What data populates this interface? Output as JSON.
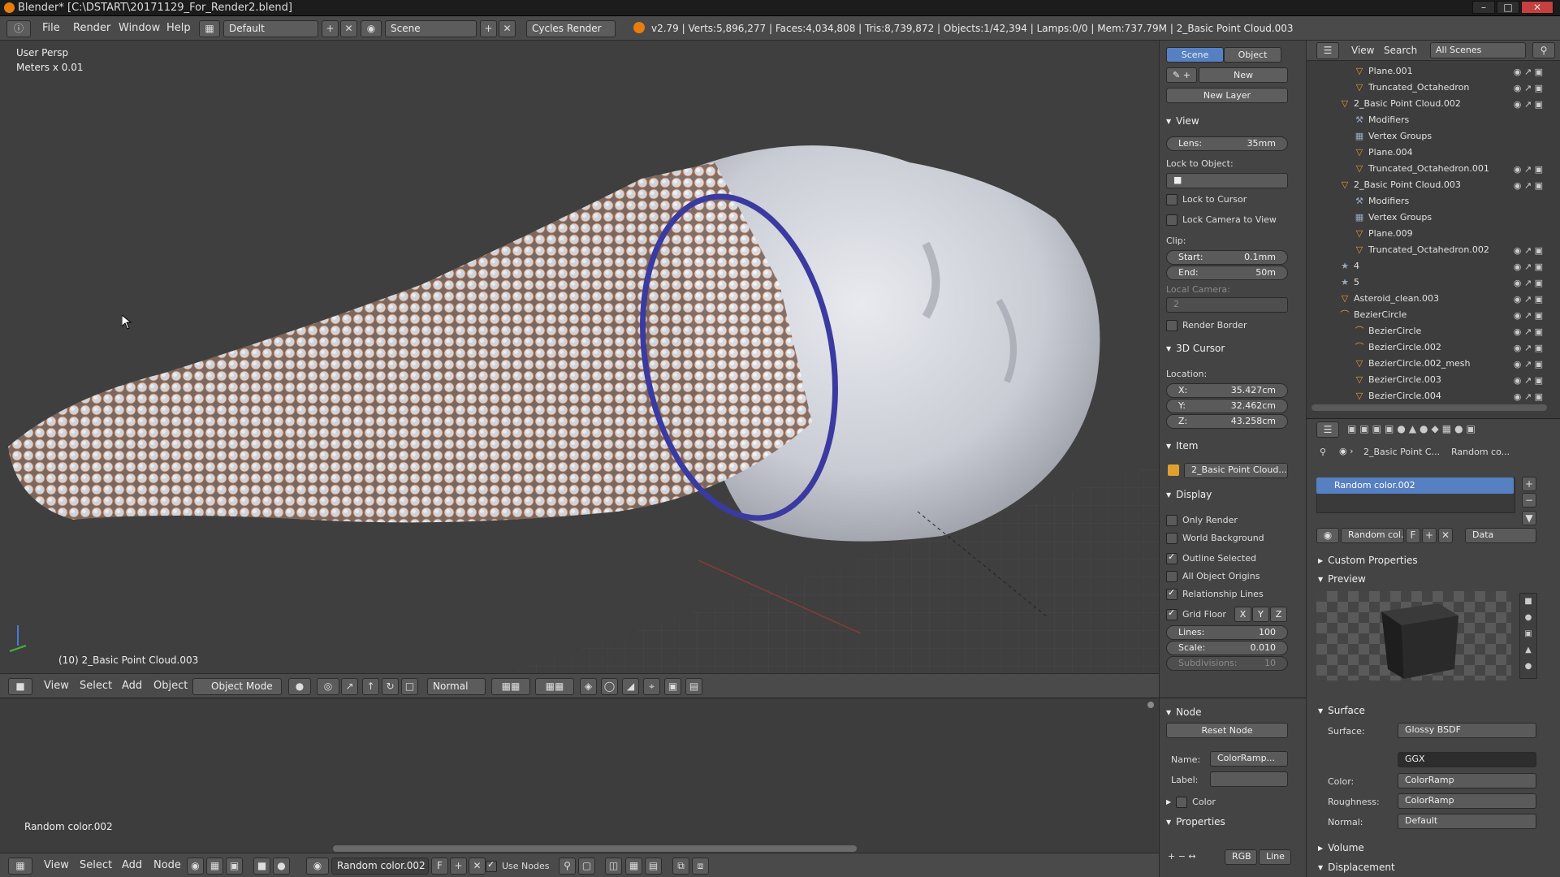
{
  "window": {
    "title": "Blender* [C:\\DSTART\\20171129_For_Render2.blend]",
    "minimize": "–",
    "maximize": "□",
    "close": "✕"
  },
  "info_header": {
    "menus": [
      "File",
      "Render",
      "Window",
      "Help"
    ],
    "screen_layout": "Default",
    "scene": "Scene",
    "render_engine": "Cycles Render",
    "stats": "v2.79 | Verts:5,896,277 | Faces:4,034,808 | Tris:8,739,872 | Objects:1/42,394 | Lamps:0/0 | Mem:737.79M | 2_Basic Point Cloud.003"
  },
  "viewport": {
    "view_name": "User Persp",
    "units": "Meters x 0.01",
    "active_object": "(10) 2_Basic Point Cloud.003"
  },
  "viewport_header": {
    "menus": [
      "View",
      "Select",
      "Add",
      "Object"
    ],
    "mode": "Object Mode",
    "orientation": "Normal"
  },
  "n_panel": {
    "tabs": [
      "Scene",
      "Object"
    ],
    "new_button": "New",
    "new_layer_button": "New Layer",
    "view": {
      "title": "View",
      "lens_label": "Lens:",
      "lens_value": "35mm",
      "lock_to_object": "Lock to Object:",
      "lock_to_cursor": "Lock to Cursor",
      "lock_camera_to_view": "Lock Camera to View",
      "clip": "Clip:",
      "clip_start_label": "Start:",
      "clip_start_value": "0.1mm",
      "clip_end_label": "End:",
      "clip_end_value": "50m",
      "local_camera": "Local Camera:",
      "local_camera_value": "2",
      "render_border": "Render Border"
    },
    "cursor_3d": {
      "title": "3D Cursor",
      "location": "Location:",
      "x_label": "X:",
      "x_value": "35.427cm",
      "y_label": "Y:",
      "y_value": "32.462cm",
      "z_label": "Z:",
      "z_value": "43.258cm"
    },
    "item": {
      "title": "Item",
      "name": "2_Basic Point Cloud..."
    },
    "display": {
      "title": "Display",
      "only_render": "Only Render",
      "world_background": "World Background",
      "outline_selected": "Outline Selected",
      "all_object_origins": "All Object Origins",
      "relationship_lines": "Relationship Lines",
      "grid_floor": "Grid Floor",
      "axis_x": "X",
      "axis_y": "Y",
      "axis_z": "Z",
      "lines_label": "Lines:",
      "lines_value": "100",
      "scale_label": "Scale:",
      "scale_value": "0.010",
      "subdivisions_label": "Subdivisions:",
      "subdivisions_value": "10"
    }
  },
  "node_panel": {
    "title": "Node",
    "reset_node": "Reset Node",
    "name_label": "Name:",
    "name_value": "ColorRamp...",
    "label_label": "Label:",
    "color_section": "Color",
    "properties_section": "Properties",
    "color_mode": "RGB",
    "interp": "Line"
  },
  "node_editor": {
    "material_label": "Random color.002",
    "menus": [
      "View",
      "Select",
      "Add",
      "Node"
    ],
    "material": "Random color.002",
    "fake_user": "F",
    "use_nodes": "Use Nodes"
  },
  "outliner": {
    "view_menu": "View",
    "search_menu": "Search",
    "scope": "All Scenes",
    "rows": [
      {
        "name": "Plane.001",
        "icon": "mesh-icon"
      },
      {
        "name": "Truncated_Octahedron",
        "icon": "mesh-icon"
      },
      {
        "name": "2_Basic Point Cloud.002",
        "icon": "mesh-icon"
      },
      {
        "name": "Modifiers",
        "icon": "wrench-icon"
      },
      {
        "name": "Vertex Groups",
        "icon": "vertex-groups-icon"
      },
      {
        "name": "Plane.004",
        "icon": "mesh-icon"
      },
      {
        "name": "Truncated_Octahedron.001",
        "icon": "mesh-icon"
      },
      {
        "name": "2_Basic Point Cloud.003",
        "icon": "mesh-icon"
      },
      {
        "name": "Modifiers",
        "icon": "wrench-icon"
      },
      {
        "name": "Vertex Groups",
        "icon": "vertex-groups-icon"
      },
      {
        "name": "Plane.009",
        "icon": "mesh-icon"
      },
      {
        "name": "Truncated_Octahedron.002",
        "icon": "mesh-icon"
      },
      {
        "name": "4",
        "icon": "group-icon"
      },
      {
        "name": "5",
        "icon": "group-icon"
      },
      {
        "name": "Asteroid_clean.003",
        "icon": "mesh-icon"
      },
      {
        "name": "BezierCircle",
        "icon": "curve-icon"
      },
      {
        "name": "BezierCircle",
        "icon": "curve-icon"
      },
      {
        "name": "BezierCircle.002",
        "icon": "curve-icon"
      },
      {
        "name": "BezierCircle.002_mesh",
        "icon": "mesh-icon"
      },
      {
        "name": "BezierCircle.003",
        "icon": "mesh-icon"
      },
      {
        "name": "BezierCircle.004",
        "icon": "mesh-icon"
      }
    ]
  },
  "properties": {
    "breadcrumb_object": "2_Basic Point C...",
    "breadcrumb_material": "Random co...",
    "material_slot": "Random color.002",
    "material_field": "Random col...",
    "fake_user": "F",
    "link": "Data",
    "custom_properties": "Custom Properties",
    "preview": "Preview",
    "surface_section": "Surface",
    "surface_label": "Surface:",
    "surface_value": "Glossy BSDF",
    "distribution_value": "GGX",
    "color_label": "Color:",
    "color_value": "ColorRamp",
    "roughness_label": "Roughness:",
    "roughness_value": "ColorRamp",
    "normal_label": "Normal:",
    "normal_value": "Default",
    "volume_section": "Volume",
    "displacement_section": "Displacement"
  },
  "colors": {
    "accent_blue": "#5680c2",
    "blender_orange": "#e87d0d",
    "ring_blue": "#3a3aa0",
    "mesh_white": "#d9dbe0",
    "selection_orange": "#d07a3a"
  }
}
